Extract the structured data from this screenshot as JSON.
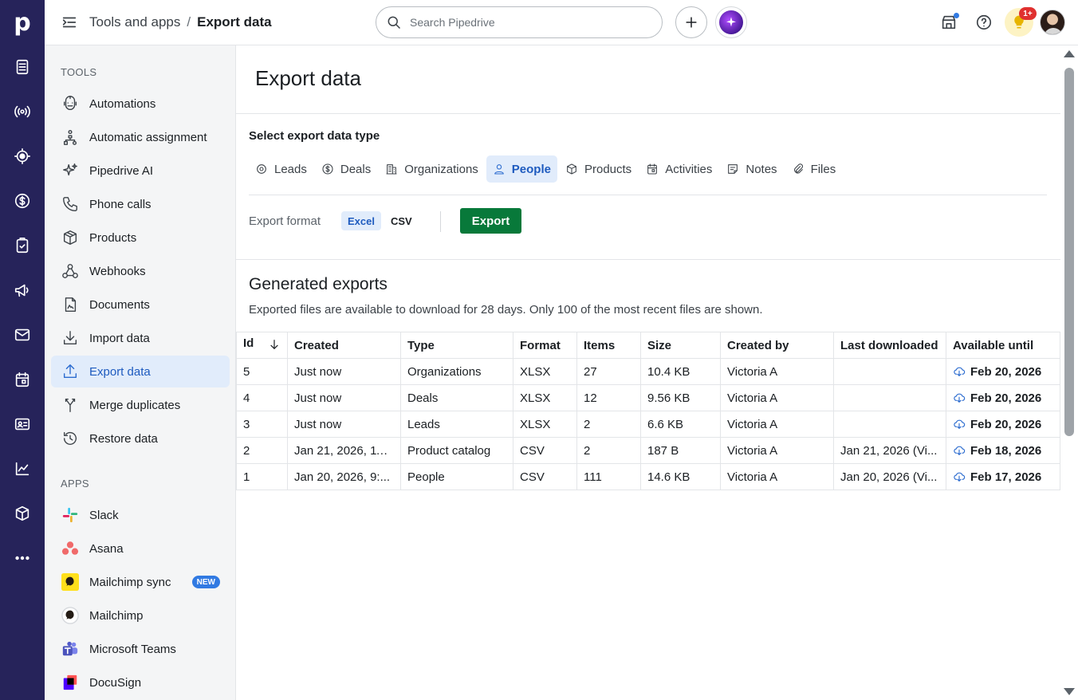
{
  "header": {
    "breadcrumb_parent": "Tools and apps",
    "breadcrumb_sep": "/",
    "breadcrumb_current": "Export data",
    "search_placeholder": "Search Pipedrive",
    "notif_count": "1+"
  },
  "sidebar": {
    "tools_label": "TOOLS",
    "tools": [
      {
        "label": "Automations",
        "icon": "robot-icon"
      },
      {
        "label": "Automatic assignment",
        "icon": "assignment-icon"
      },
      {
        "label": "Pipedrive AI",
        "icon": "sparkle-icon"
      },
      {
        "label": "Phone calls",
        "icon": "phone-icon"
      },
      {
        "label": "Products",
        "icon": "box-icon"
      },
      {
        "label": "Webhooks",
        "icon": "webhook-icon"
      },
      {
        "label": "Documents",
        "icon": "document-icon"
      },
      {
        "label": "Import data",
        "icon": "import-icon"
      },
      {
        "label": "Export data",
        "icon": "export-icon"
      },
      {
        "label": "Merge duplicates",
        "icon": "merge-icon"
      },
      {
        "label": "Restore data",
        "icon": "restore-icon"
      }
    ],
    "apps_label": "APPS",
    "apps": [
      {
        "label": "Slack",
        "icon": "slack-icon"
      },
      {
        "label": "Asana",
        "icon": "asana-icon"
      },
      {
        "label": "Mailchimp sync",
        "icon": "mailchimp-icon",
        "badge": "NEW"
      },
      {
        "label": "Mailchimp",
        "icon": "mailchimp-icon"
      },
      {
        "label": "Microsoft Teams",
        "icon": "teams-icon"
      },
      {
        "label": "DocuSign",
        "icon": "docusign-icon"
      }
    ]
  },
  "main": {
    "title": "Export data",
    "select_label": "Select export data type",
    "types": [
      {
        "label": "Leads",
        "icon": "target-icon"
      },
      {
        "label": "Deals",
        "icon": "dollar-icon"
      },
      {
        "label": "Organizations",
        "icon": "building-icon"
      },
      {
        "label": "People",
        "icon": "person-icon",
        "active": true
      },
      {
        "label": "Products",
        "icon": "box-icon"
      },
      {
        "label": "Activities",
        "icon": "calendar-icon"
      },
      {
        "label": "Notes",
        "icon": "note-icon"
      },
      {
        "label": "Files",
        "icon": "paperclip-icon"
      }
    ],
    "format_label": "Export format",
    "format_excel": "Excel",
    "format_csv": "CSV",
    "export_button": "Export",
    "generated_title": "Generated exports",
    "generated_desc": "Exported files are available to download for 28 days. Only 100 of the most recent files are shown.",
    "columns": [
      "Id",
      "Created",
      "Type",
      "Format",
      "Items",
      "Size",
      "Created by",
      "Last downloaded",
      "Available until"
    ],
    "rows": [
      {
        "id": "5",
        "created": "Just now",
        "type": "Organizations",
        "format": "XLSX",
        "items": "27",
        "size": "10.4 KB",
        "created_by": "Victoria A",
        "last_downloaded": "",
        "available_until": "Feb 20, 2026"
      },
      {
        "id": "4",
        "created": "Just now",
        "type": "Deals",
        "format": "XLSX",
        "items": "12",
        "size": "9.56 KB",
        "created_by": "Victoria A",
        "last_downloaded": "",
        "available_until": "Feb 20, 2026"
      },
      {
        "id": "3",
        "created": "Just now",
        "type": "Leads",
        "format": "XLSX",
        "items": "2",
        "size": "6.6 KB",
        "created_by": "Victoria A",
        "last_downloaded": "",
        "available_until": "Feb 20, 2026"
      },
      {
        "id": "2",
        "created": "Jan 21, 2026, 11:...",
        "type": "Product catalog",
        "format": "CSV",
        "items": "2",
        "size": "187 B",
        "created_by": "Victoria A",
        "last_downloaded": "Jan 21, 2026 (Vi...",
        "available_until": "Feb 18, 2026"
      },
      {
        "id": "1",
        "created": "Jan 20, 2026, 9:...",
        "type": "People",
        "format": "CSV",
        "items": "111",
        "size": "14.6 KB",
        "created_by": "Victoria A",
        "last_downloaded": "Jan 20, 2026 (Vi...",
        "available_until": "Feb 17, 2026"
      }
    ]
  },
  "colors": {
    "rail": "#26235a",
    "accent": "#317ae2",
    "export_green": "#08793a",
    "active_bg": "#e1ecfb"
  }
}
